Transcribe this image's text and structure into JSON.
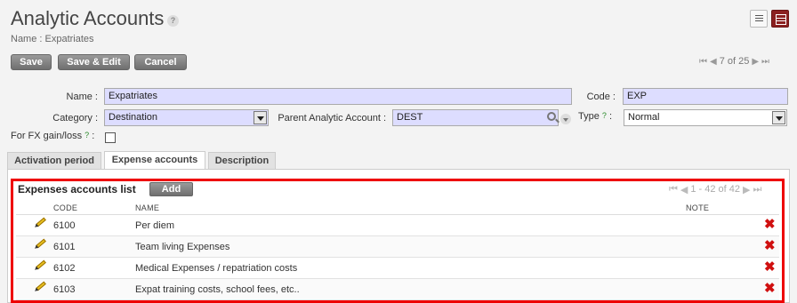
{
  "header": {
    "title": "Analytic Accounts",
    "help": "?",
    "breadcrumb": "Name : Expatriates"
  },
  "toolbar": {
    "save_label": "Save",
    "save_edit_label": "Save & Edit",
    "cancel_label": "Cancel"
  },
  "pager": {
    "first": "⏮",
    "prev": "◀",
    "text": "7 of 25",
    "next": "▶",
    "last": "⏭"
  },
  "form": {
    "name_label": "Name :",
    "name_value": "Expatriates",
    "code_label": "Code :",
    "code_value": "EXP",
    "category_label": "Category :",
    "category_value": "Destination",
    "parent_label": "Parent Analytic Account :",
    "parent_value": "DEST",
    "type_label": "Type",
    "type_help": "?",
    "type_colon": ":",
    "type_value": "Normal",
    "fx_label": "For FX gain/loss",
    "fx_help": "?",
    "fx_colon": ":",
    "fx_checked": false
  },
  "tabs": [
    {
      "label": "Activation period"
    },
    {
      "label": "Expense accounts"
    },
    {
      "label": "Description"
    }
  ],
  "list": {
    "title": "Expenses accounts list",
    "add_label": "Add",
    "pager_text": "1 - 42 of 42",
    "columns": {
      "code": "CODE",
      "name": "NAME",
      "note": "NOTE"
    },
    "rows": [
      {
        "code": "6100",
        "name": "Per diem"
      },
      {
        "code": "6101",
        "name": "Team living Expenses"
      },
      {
        "code": "6102",
        "name": "Medical Expenses / repatriation costs"
      },
      {
        "code": "6103",
        "name": "Expat training costs, school fees, etc.."
      }
    ]
  },
  "colors": {
    "highlight_border": "#ee0000",
    "field_bg": "#ddddff",
    "delete": "#d01010"
  }
}
